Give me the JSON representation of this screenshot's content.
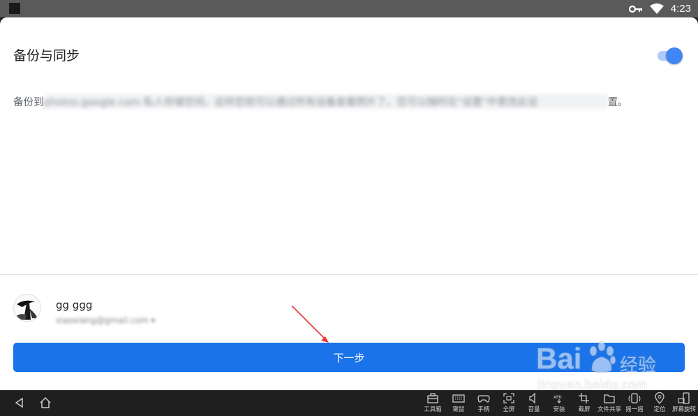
{
  "status_bar": {
    "time": "4:23",
    "icons": [
      "key-icon",
      "wifi-icon"
    ]
  },
  "dialog": {
    "title": "备份与同步",
    "toggle_on": true,
    "description_prefix": "备份到",
    "description_blurred": "photos.google.com 私人存储空间。这样您就可以通过所有设备查看照片了。您可以随时在\"设置\"中更改此设",
    "description_suffix": "置。",
    "accent_color": "#1a73e8"
  },
  "account": {
    "name": "gg ggg",
    "email": "xiaoxiang@gmail.com ▾"
  },
  "next_button": {
    "label": "下一步"
  },
  "watermark": {
    "brand": "Bai",
    "jingyan": "经验",
    "url": "jingyan.baidu.com"
  },
  "toolbar": {
    "items": [
      {
        "label": "工具箱",
        "icon": "toolbox-icon"
      },
      {
        "label": "键鼠",
        "icon": "keyboard-icon"
      },
      {
        "label": "手柄",
        "icon": "gamepad-icon"
      },
      {
        "label": "全屏",
        "icon": "fullscreen-icon"
      },
      {
        "label": "音量",
        "icon": "volume-icon"
      },
      {
        "label": "安装",
        "icon": "apk-install-icon"
      },
      {
        "label": "截屏",
        "icon": "screenshot-icon"
      },
      {
        "label": "文件共享",
        "icon": "folder-share-icon"
      },
      {
        "label": "摇一摇",
        "icon": "shake-icon"
      },
      {
        "label": "定位",
        "icon": "location-icon"
      },
      {
        "label": "屏幕旋转",
        "icon": "rotate-screen-icon"
      }
    ]
  }
}
